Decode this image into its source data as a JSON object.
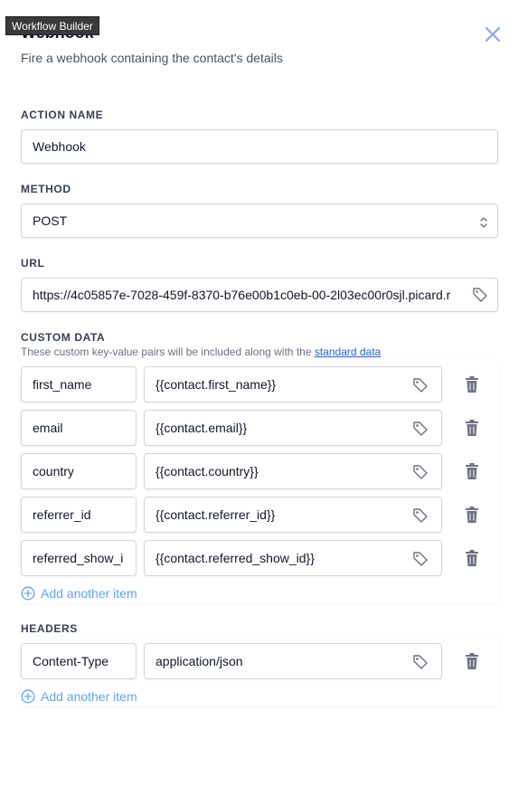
{
  "tooltip": "Workflow Builder",
  "header": {
    "title": "Webhook",
    "subtitle": "Fire a webhook containing the contact's details"
  },
  "action_name": {
    "label": "ACTION NAME",
    "value": "Webhook"
  },
  "method": {
    "label": "METHOD",
    "value": "POST"
  },
  "url": {
    "label": "URL",
    "value": "https://4c05857e-7028-459f-8370-b76e00b1c0eb-00-2l03ec00r0sjl.picard.r"
  },
  "custom_data": {
    "label": "CUSTOM DATA",
    "description": "These custom key-value pairs will be included along with the",
    "link": "standard data",
    "rows": [
      {
        "key": "first_name",
        "value": "{{contact.first_name}}"
      },
      {
        "key": "email",
        "value": "{{contact.email}}"
      },
      {
        "key": "country",
        "value": "{{contact.country}}"
      },
      {
        "key": "referrer_id",
        "value": "{{contact.referrer_id}}"
      },
      {
        "key": "referred_show_i",
        "value": "{{contact.referred_show_id}}"
      }
    ],
    "add_label": "Add another item"
  },
  "headers": {
    "label": "HEADERS",
    "rows": [
      {
        "key": "Content-Type",
        "value": "application/json"
      }
    ],
    "add_label": "Add another item"
  },
  "icons": {
    "close": "close-icon",
    "select": "chevron-up-down-icon",
    "tag": "tag-icon",
    "trash": "trash-icon",
    "plus": "plus-circle-icon"
  },
  "colors": {
    "accent": "#60a5fa",
    "link": "#2563eb",
    "close": "#93a4f5",
    "icon_gray": "#6b7280"
  }
}
